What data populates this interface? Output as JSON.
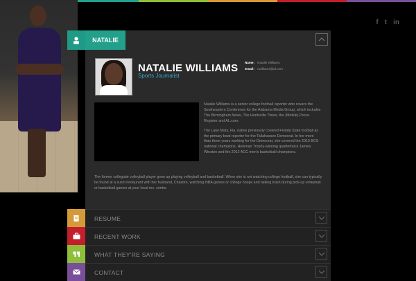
{
  "colors": {
    "teal": "#22a08b",
    "link_blue": "#3da6c9",
    "resume": "#d49a3a",
    "recent_work": "#c21e2c",
    "what_theyre_saying": "#8fbf3a",
    "contact": "#7a4f9a"
  },
  "social": {
    "facebook": "f",
    "twitter": "t",
    "linkedin": "in"
  },
  "tab": {
    "label": "NATALIE",
    "icon": "person-icon"
  },
  "profile": {
    "name": "NATALIE WILLIAMS",
    "title": "Sports Journalist",
    "name_label": "Name:",
    "name_value": "Natalie Williams",
    "email_label": "Email:",
    "email_value": "nwilliams@al.com"
  },
  "bio": {
    "p1": "Natalie Williams is a senior college football reporter who covers the Southeastern Conference for the Alabama Media Group, which includes The Birmingham News, The Huntsville Times, the (Mobile) Press-Register and AL.com.",
    "p2": "The Lake Mary, Fla. native previously covered Florida State football as the primary beat reporter for the Tallahassee Democrat. In her more than three years working for the Democrat, she covered the 2013 BCS national champions, Heisman Trophy-winning quarterback Jameis Winston and the 2012 ACC men's basketball champions.",
    "p3": "The former collegiate volleyball player grew up playing volleyball and basketball. When she is not watching college football, she can typically be found at a sushi restaurant with her husband, Chasten, watching NBA games or college hoops and talking trash during pick-up volleyball or basketball games at your local rec. center."
  },
  "sections": [
    {
      "label": "RESUME",
      "icon": "document-icon"
    },
    {
      "label": "RECENT WORK",
      "icon": "briefcase-icon"
    },
    {
      "label": "WHAT THEY'RE SAYING",
      "icon": "quote-icon"
    },
    {
      "label": "CONTACT",
      "icon": "envelope-icon"
    }
  ]
}
